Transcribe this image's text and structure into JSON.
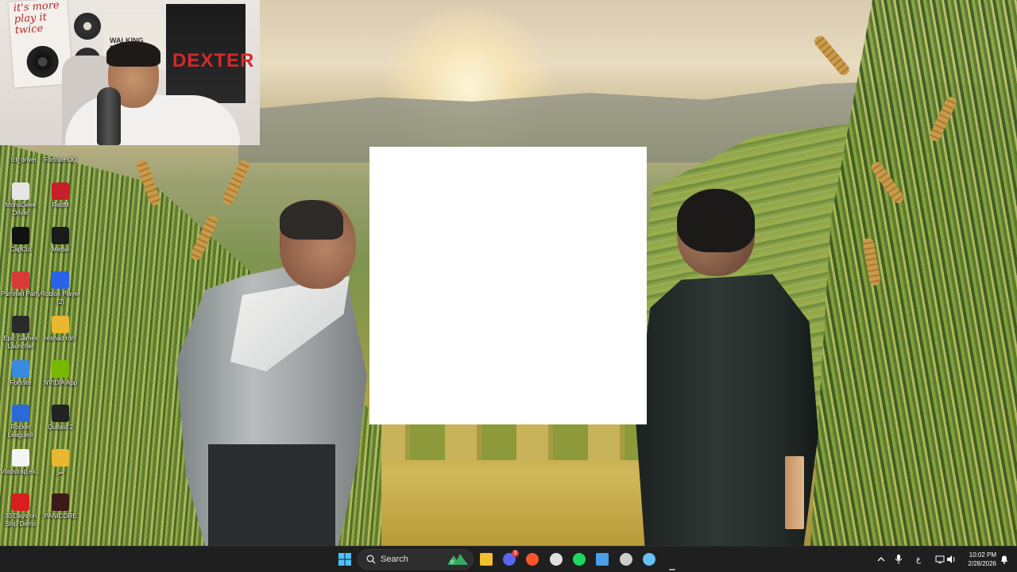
{
  "desktop": {
    "partial_top": [
      {
        "label": "ict_driver"
      },
      {
        "label": "Fortnite OG"
      }
    ],
    "icons": [
      {
        "label": "MonsGeek Driver",
        "color": "#e6e6e6"
      },
      {
        "label": "RedM",
        "color": "#c8202a"
      },
      {
        "label": "CapCut",
        "color": "#111111"
      },
      {
        "label": "Medal",
        "color": "#1a1a1a"
      },
      {
        "label": "Pummel Party",
        "color": "#d83a3a"
      },
      {
        "label": "Roblox Player (2)",
        "color": "#2a62e8"
      },
      {
        "label": "Epic Games Launcher",
        "color": "#2a2a2a"
      },
      {
        "label": "reshad rdm",
        "color": "#e8b830"
      },
      {
        "label": "Fortnite",
        "color": "#3a8ae0"
      },
      {
        "label": "NVIDIA App",
        "color": "#76b900"
      },
      {
        "label": "Rocket League®",
        "color": "#2a6ad8"
      },
      {
        "label": "Outlast 2",
        "color": "#222222"
      },
      {
        "label": "Voidstrap.ex...",
        "color": "#f4f4f4"
      },
      {
        "label": "بتر",
        "color": "#e8b830"
      },
      {
        "label": "30 Days on Ship Demo",
        "color": "#d81e1e"
      },
      {
        "label": "PANICORE",
        "color": "#3a1a1a"
      }
    ]
  },
  "webcam": {
    "poster_left_text": "it's more\nplay it\ntwice",
    "poster_mid_text": "WALKING DEAD",
    "poster_right_text": "DEXTER"
  },
  "taskbar": {
    "search_placeholder": "Search",
    "pinned": [
      {
        "name": "file-explorer",
        "color": "#f2c02c"
      },
      {
        "name": "discord",
        "color": "#5865f2",
        "badge": "3"
      },
      {
        "name": "brave",
        "color": "#fb542b"
      },
      {
        "name": "obs",
        "color": "#e0e0e0"
      },
      {
        "name": "spotify",
        "color": "#1ed760"
      },
      {
        "name": "snipping",
        "color": "#4aa0e6"
      },
      {
        "name": "chrome",
        "color": "#cccccc"
      },
      {
        "name": "steam",
        "color": "#66c0f4"
      },
      {
        "name": "active-app",
        "color": "#888888"
      }
    ],
    "tray": {
      "lang": "ع",
      "time": "10:02 PM",
      "date": "2/28/2026"
    }
  }
}
